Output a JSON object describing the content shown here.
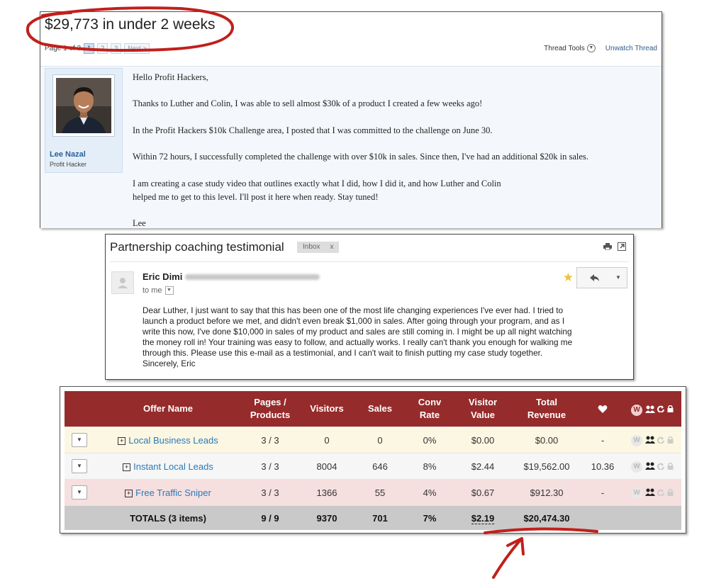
{
  "forum": {
    "title": "$29,773 in under 2 weeks",
    "pager": {
      "prefix": "Page 1 of 3",
      "pages": [
        "1",
        "2",
        "3"
      ],
      "next": "Next >"
    },
    "thread_tools": "Thread Tools",
    "unwatch": "Unwatch Thread",
    "user": {
      "name": "Lee Nazal",
      "title": "Profit Hacker"
    },
    "post": [
      "Hello Profit Hackers,",
      "Thanks to Luther and Colin, I was able to sell almost $30k of a product I created a few weeks ago!",
      "In the Profit Hackers $10k Challenge area, I posted that I was committed to the challenge on June 30.",
      "Within 72 hours, I successfully completed the challenge with over $10k in sales. Since then, I've had an additional $20k in sales.",
      "I am creating a case study video that outlines exactly what I did, how I did it, and how Luther and Colin",
      "helped me to get to this level. I'll post it here when ready. Stay tuned!",
      "Lee"
    ]
  },
  "email": {
    "subject": "Partnership coaching testimonial",
    "label": "Inbox",
    "label_close": "x",
    "sender": "Eric Dimi",
    "to": "to me",
    "body": [
      "Dear Luther, I just want to say that this has been one of the most life changing experiences I've ever had. I tried to",
      "launch a product before we met, and didn't even break $1,000 in sales. After going through your program, and as I",
      "write this now, I've done $10,000 in sales of my product and sales are still coming in. I might be up all night watching",
      "the money roll in! Your training was easy to follow, and actually works. I really can't thank you enough for walking me",
      "through this. Please use this e-mail as a testimonial, and I can't wait to finish putting my case study together.",
      "Sincerely, Eric"
    ]
  },
  "table": {
    "headers": {
      "offer_name": "Offer Name",
      "pages_1": "Pages /",
      "pages_2": "Products",
      "visitors": "Visitors",
      "sales": "Sales",
      "conv_1": "Conv",
      "conv_2": "Rate",
      "vv_1": "Visitor",
      "vv_2": "Value",
      "tr_1": "Total",
      "tr_2": "Revenue",
      "w_badge": "W"
    },
    "rows": [
      {
        "name": "Local Business Leads",
        "pages": "3 / 3",
        "visitors": "0",
        "sales": "0",
        "conv": "0%",
        "vv": "$0.00",
        "revenue": "$0.00",
        "heart": "-",
        "w": "W"
      },
      {
        "name": "Instant Local Leads",
        "pages": "3 / 3",
        "visitors": "8004",
        "sales": "646",
        "conv": "8%",
        "vv": "$2.44",
        "revenue": "$19,562.00",
        "heart": "10.36",
        "w": "W"
      },
      {
        "name": "Free Traffic Sniper",
        "pages": "3 / 3",
        "visitors": "1366",
        "sales": "55",
        "conv": "4%",
        "vv": "$0.67",
        "revenue": "$912.30",
        "heart": "-",
        "w": "W"
      }
    ],
    "totals": {
      "label": "TOTALS (3 items)",
      "pages": "9 / 9",
      "visitors": "9370",
      "sales": "701",
      "conv": "7%",
      "vv": "$2.19",
      "revenue": "$20,474.30"
    }
  },
  "colors": {
    "header_red": "#962b2b",
    "annotation_red": "#c0201c",
    "link_blue": "#2a7ab8",
    "star": "#f0c23c"
  }
}
